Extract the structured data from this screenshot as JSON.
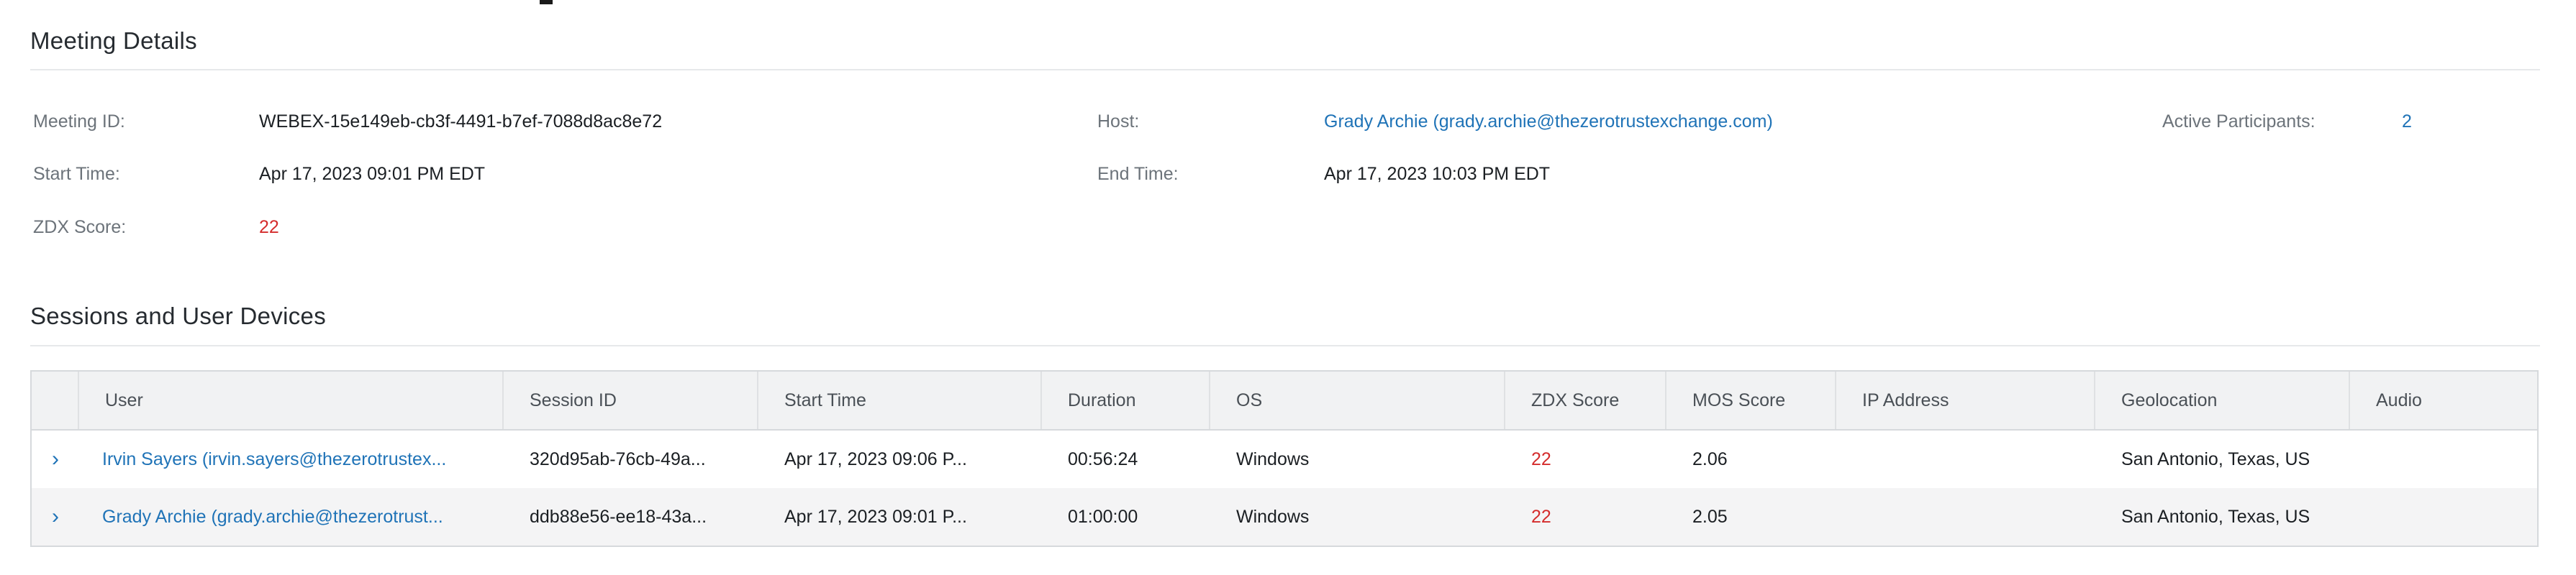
{
  "meeting_details": {
    "title": "Meeting Details",
    "fields": {
      "meeting_id": {
        "label": "Meeting ID:",
        "value": "WEBEX-15e149eb-cb3f-4491-b7ef-7088d8ac8e72"
      },
      "start_time": {
        "label": "Start Time:",
        "value": "Apr 17, 2023 09:01 PM EDT"
      },
      "zdx_score": {
        "label": "ZDX Score:",
        "value": "22"
      },
      "host": {
        "label": "Host:",
        "value": "Grady Archie (grady.archie@thezerotrustexchange.com)"
      },
      "end_time": {
        "label": "End Time:",
        "value": "Apr 17, 2023 10:03 PM EDT"
      },
      "active_participants": {
        "label": "Active Participants:",
        "value": "2"
      }
    }
  },
  "sessions": {
    "title": "Sessions and User Devices",
    "columns": [
      "User",
      "Session ID",
      "Start Time",
      "Duration",
      "OS",
      "ZDX Score",
      "MOS Score",
      "IP Address",
      "Geolocation",
      "Audio"
    ],
    "rows": [
      {
        "user": "Irvin Sayers (irvin.sayers@thezerotrustex...",
        "session_id": "320d95ab-76cb-49a...",
        "start_time": "Apr 17, 2023 09:06 P...",
        "duration": "00:56:24",
        "os": "Windows",
        "zdx_score": "22",
        "mos_score": "2.06",
        "ip_address": "",
        "geolocation": "San Antonio, Texas, US",
        "audio": ""
      },
      {
        "user": "Grady Archie (grady.archie@thezerotrust...",
        "session_id": "ddb88e56-ee18-43a...",
        "start_time": "Apr 17, 2023 09:01 P...",
        "duration": "01:00:00",
        "os": "Windows",
        "zdx_score": "22",
        "mos_score": "2.05",
        "ip_address": "",
        "geolocation": "San Antonio, Texas, US",
        "audio": ""
      }
    ]
  },
  "icons": {
    "expand": "chevron-right-icon"
  },
  "colors": {
    "link": "#1f73b7",
    "score_bad": "#d42c2c",
    "header_bg": "#f1f2f3",
    "alt_row_bg": "#f4f4f5"
  }
}
